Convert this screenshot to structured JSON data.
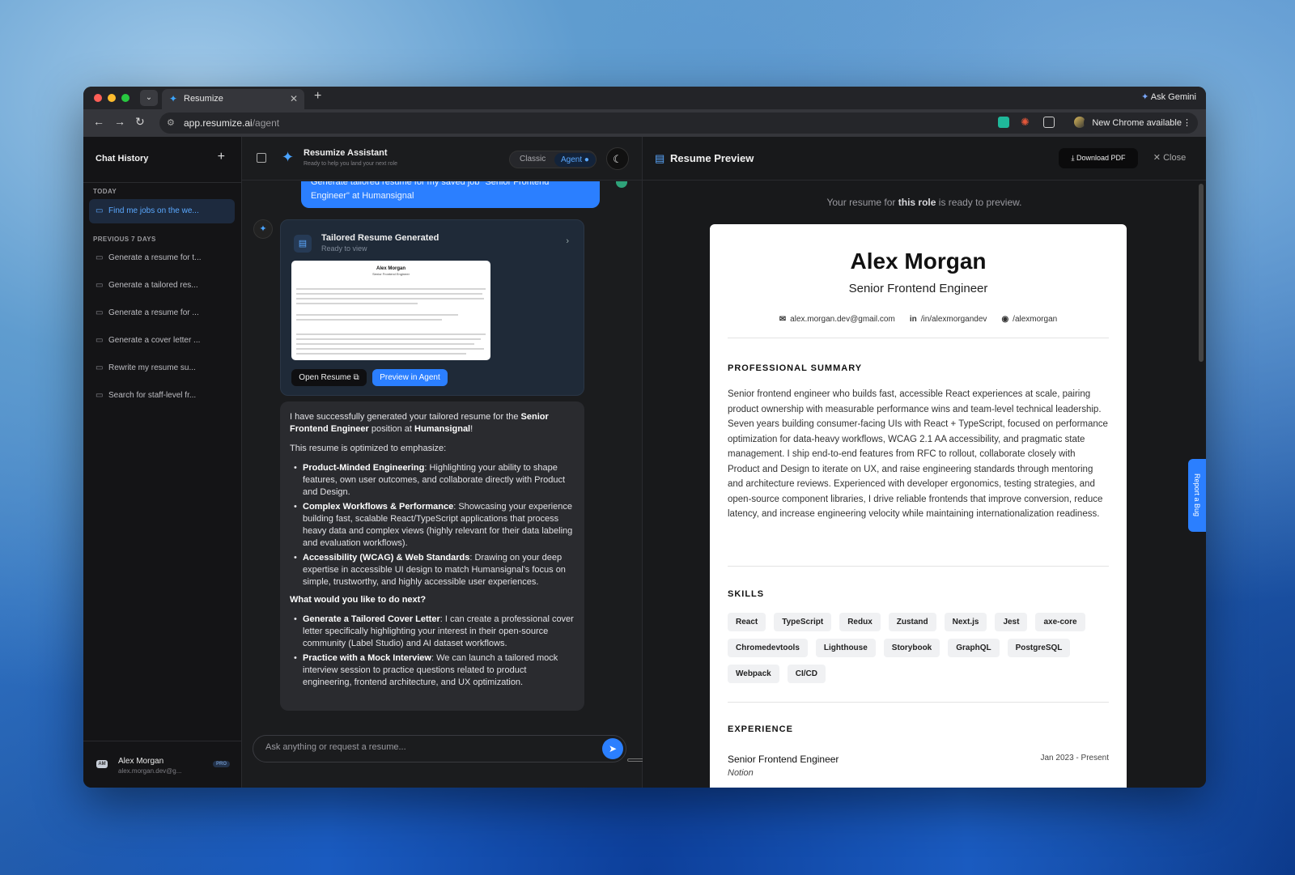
{
  "browser": {
    "tab_title": "Resumize",
    "url_host": "app.resumize.ai",
    "url_path": "/agent",
    "gemini": "Ask Gemini",
    "chrome_update": "New Chrome available"
  },
  "sidebar": {
    "title": "Chat History",
    "today_label": "TODAY",
    "active_item": "Find me jobs on the we...",
    "prev_label": "PREVIOUS 7 DAYS",
    "items": [
      "Generate a resume for t...",
      "Generate a tailored res...",
      "Generate a resume for ...",
      "Generate a cover letter ...",
      "Rewrite my resume su...",
      "Search for staff-level fr..."
    ],
    "user_name": "Alex Morgan",
    "user_email": "alex.morgan.dev@g...",
    "badge": "PRO",
    "avatar": "AM"
  },
  "chat": {
    "title": "Resumize Assistant",
    "subtitle": "Ready to help you land your next role",
    "mode_classic": "Classic",
    "mode_agent": "Agent",
    "user_msg_line1": "Generate tailored resume for my saved job \"Senior Frontend",
    "user_msg_line2": "Engineer\" at Humansignal",
    "card_title": "Tailored Resume Generated",
    "card_sub": "Ready to view",
    "thumb_name": "Alex Morgan",
    "thumb_role": "Senior Frontend Engineer",
    "open_btn": "Open Resume ⧉",
    "preview_btn": "Preview in Agent",
    "m_intro_a": "I have successfully generated your tailored resume for the ",
    "m_intro_b": "Senior Frontend Engineer",
    "m_intro_c": " position at ",
    "m_intro_d": "Humansignal",
    "m_intro_e": "!",
    "m_opt": "This resume is optimized to emphasize:",
    "b1_t": "Product-Minded Engineering",
    "b1_d": ": Highlighting your ability to shape features, own user outcomes, and collaborate directly with Product and Design.",
    "b2_t": "Complex Workflows & Performance",
    "b2_d": ": Showcasing your experience building fast, scalable React/TypeScript applications that process heavy data and complex views (highly relevant for their data labeling and evaluation workflows).",
    "b3_t": "Accessibility (WCAG) & Web Standards",
    "b3_d": ": Drawing on your deep expertise in accessible UI design to match Humansignal's focus on simple, trustworthy, and highly accessible user experiences.",
    "m_next": "What would you like to do next?",
    "n1_t": "Generate a Tailored Cover Letter",
    "n1_d": ": I can create a professional cover letter specifically highlighting your interest in their open-source community (Label Studio) and AI dataset workflows.",
    "n2_t": "Practice with a Mock Interview",
    "n2_d": ": We can launch a tailored mock interview session to practice questions related to product engineering, frontend architecture, and UX optimization.",
    "input_placeholder": "Ask anything or request a resume..."
  },
  "preview": {
    "title": "Resume Preview",
    "download": "Download PDF",
    "close": "Close",
    "ready_a": "Your resume for ",
    "ready_b": "this role",
    "ready_c": " is ready to preview.",
    "bug": "Report a Bug"
  },
  "resume": {
    "name": "Alex Morgan",
    "role": "Senior Frontend Engineer",
    "email": "alex.morgan.dev@gmail.com",
    "linkedin": "/in/alexmorgandev",
    "github": "/alexmorgan",
    "summary_h": "PROFESSIONAL SUMMARY",
    "summary": "Senior frontend engineer who builds fast, accessible React experiences at scale, pairing product ownership with measurable performance wins and team-level technical leadership. Seven years building consumer-facing UIs with React + TypeScript, focused on performance optimization for data-heavy workflows, WCAG 2.1 AA accessibility, and pragmatic state management. I ship end-to-end features from RFC to rollout, collaborate closely with Product and Design to iterate on UX, and raise engineering standards through mentoring and architecture reviews. Experienced with developer ergonomics, testing strategies, and open-source component libraries, I drive reliable frontends that improve conversion, reduce latency, and increase engineering velocity while maintaining internationalization readiness.",
    "skills_h": "SKILLS",
    "skills": [
      "React",
      "TypeScript",
      "Redux",
      "Zustand",
      "Next.js",
      "Jest",
      "axe-core",
      "Chromedevtools",
      "Lighthouse",
      "Storybook",
      "GraphQL",
      "PostgreSQL",
      "Webpack",
      "CI/CD"
    ],
    "exp_h": "EXPERIENCE",
    "job_title": "Senior Frontend Engineer",
    "job_company": "Notion",
    "job_date": "Jan 2023 - Present"
  },
  "colors": {
    "accent": "#2b7fff",
    "sidebar_bg": "#141416",
    "panel_bg": "#1b1c1e"
  }
}
